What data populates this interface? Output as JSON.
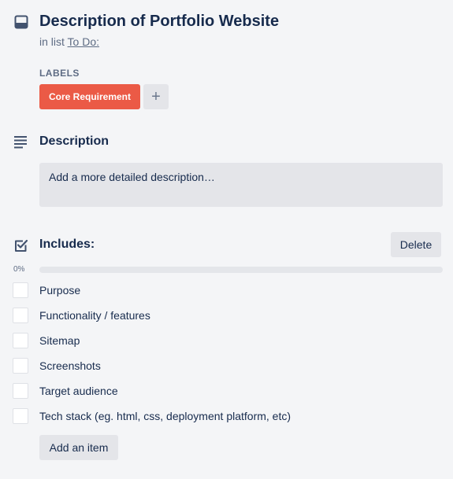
{
  "card": {
    "title": "Description of Portfolio Website",
    "in_list_prefix": "in list",
    "list_name": "To Do:"
  },
  "labels": {
    "heading": "LABELS",
    "items": [
      {
        "name": "Core Requirement",
        "color": "#eb5a46"
      }
    ],
    "add_glyph": "+"
  },
  "description": {
    "heading": "Description",
    "placeholder": "Add a more detailed description…"
  },
  "checklist": {
    "title": "Includes:",
    "delete_label": "Delete",
    "progress_text": "0%",
    "progress": 0,
    "items": [
      {
        "text": "Purpose",
        "checked": false
      },
      {
        "text": "Functionality / features",
        "checked": false
      },
      {
        "text": "Sitemap",
        "checked": false
      },
      {
        "text": "Screenshots",
        "checked": false
      },
      {
        "text": "Target audience",
        "checked": false
      },
      {
        "text": "Tech stack (eg. html, css, deployment platform, etc)",
        "checked": false
      }
    ],
    "add_item_label": "Add an item"
  },
  "icons": {
    "card": "card-icon",
    "description": "description-icon",
    "checklist": "checklist-icon",
    "add": "plus-icon"
  },
  "colors": {
    "label_red": "#eb5a46",
    "progress": "#5ba4cf",
    "text_primary": "#172b4d",
    "text_secondary": "#5e6c84"
  }
}
